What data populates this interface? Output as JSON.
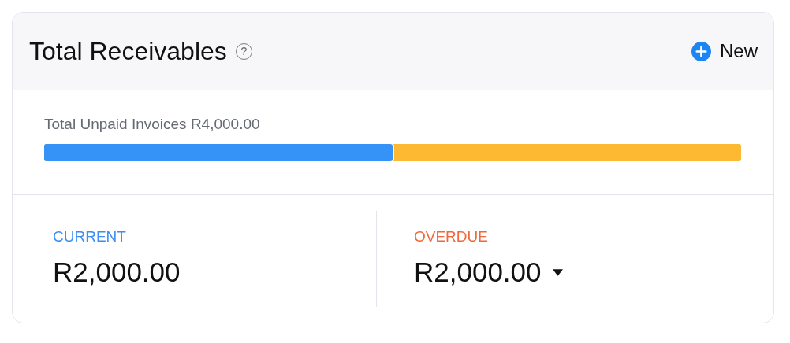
{
  "card": {
    "title": "Total Receivables",
    "help": "?",
    "new_button": {
      "label": "New"
    }
  },
  "unpaid": {
    "label": "Total Unpaid Invoices R4,000.00",
    "bar": {
      "level": 0.5
    }
  },
  "summary": [
    {
      "label": "CURRENT",
      "color": "#3a8ef6",
      "amount": "R2,000.00",
      "dropdown": false
    },
    {
      "label": "OVERDUE",
      "color": "#f2683a",
      "amount": "R2,000.00",
      "dropdown": true
    }
  ]
}
